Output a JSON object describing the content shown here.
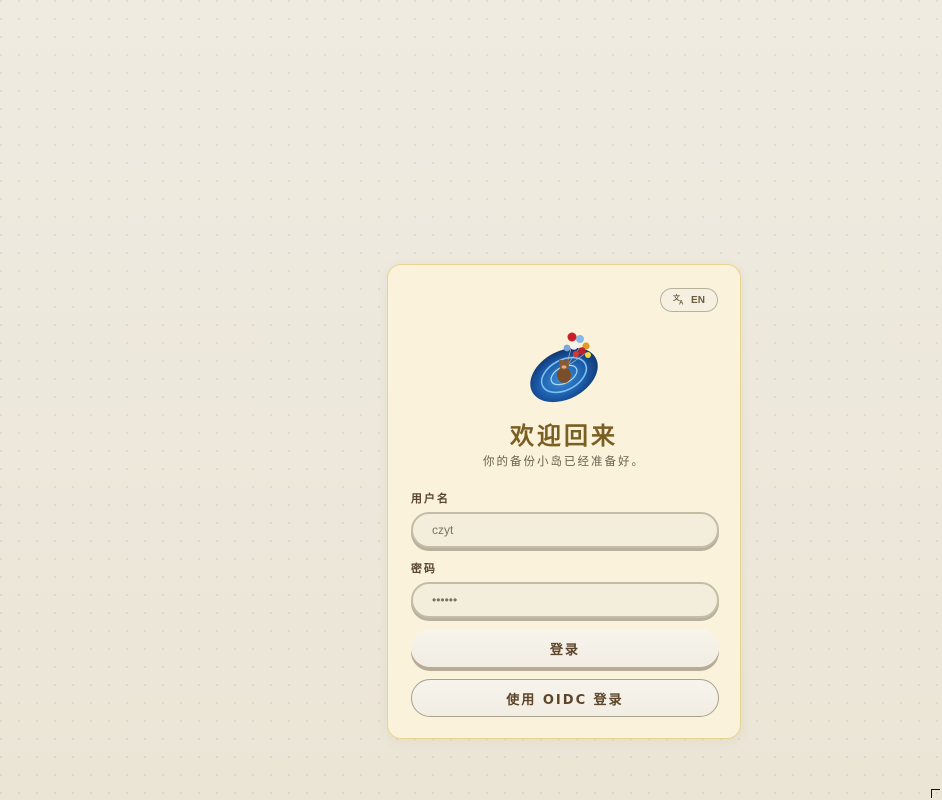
{
  "language_toggle": {
    "label": "EN",
    "icon": "translate-icon"
  },
  "logo": {
    "icon": "island-balloon-logo"
  },
  "header": {
    "title": "欢迎回来",
    "subtitle": "你的备份小岛已经准备好。"
  },
  "form": {
    "username_label": "用户名",
    "username_value": "czyt",
    "password_label": "密码",
    "password_value": "••••••"
  },
  "buttons": {
    "login": "登录",
    "oidc_login": "使用 OIDC 登录"
  },
  "colors": {
    "background": "#ede8dc",
    "card": "#faf2db",
    "card_border": "#e7d48d",
    "title": "#7a5f22",
    "button_text": "#5c4429"
  }
}
